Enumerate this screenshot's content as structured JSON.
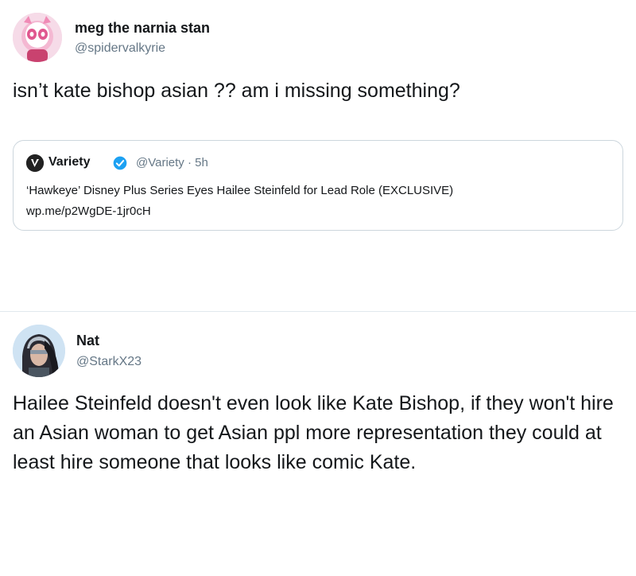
{
  "tweets": [
    {
      "display_name": "meg the narnia stan",
      "handle": "@spidervalkyrie",
      "text": "isn’t kate bishop asian ?? am i missing something?",
      "avatar_icon": "pink-masked-character-avatar",
      "quote": {
        "account_icon": "variety-logo-icon",
        "name": "Variety",
        "verified_icon": "verified-badge-icon",
        "handle": "@Variety",
        "time": "5h",
        "meta": "@Variety · 5h",
        "headline": "‘Hawkeye’ Disney Plus Series Eyes Hailee Steinfeld for Lead Role (EXCLUSIVE)",
        "link": "wp.me/p2WgDE-1jr0cH"
      }
    },
    {
      "display_name": "Nat",
      "handle": "@StarkX23",
      "text": "Hailee Steinfeld doesn't even look like Kate Bishop, if they won't hire an Asian woman to get Asian ppl more representation they could at least hire someone that looks like comic Kate.",
      "avatar_icon": "helmeted-character-avatar"
    }
  ],
  "colors": {
    "text_primary": "#14171a",
    "text_secondary": "#657786",
    "verified_blue": "#1da1f2",
    "border": "#ccd6dd"
  }
}
